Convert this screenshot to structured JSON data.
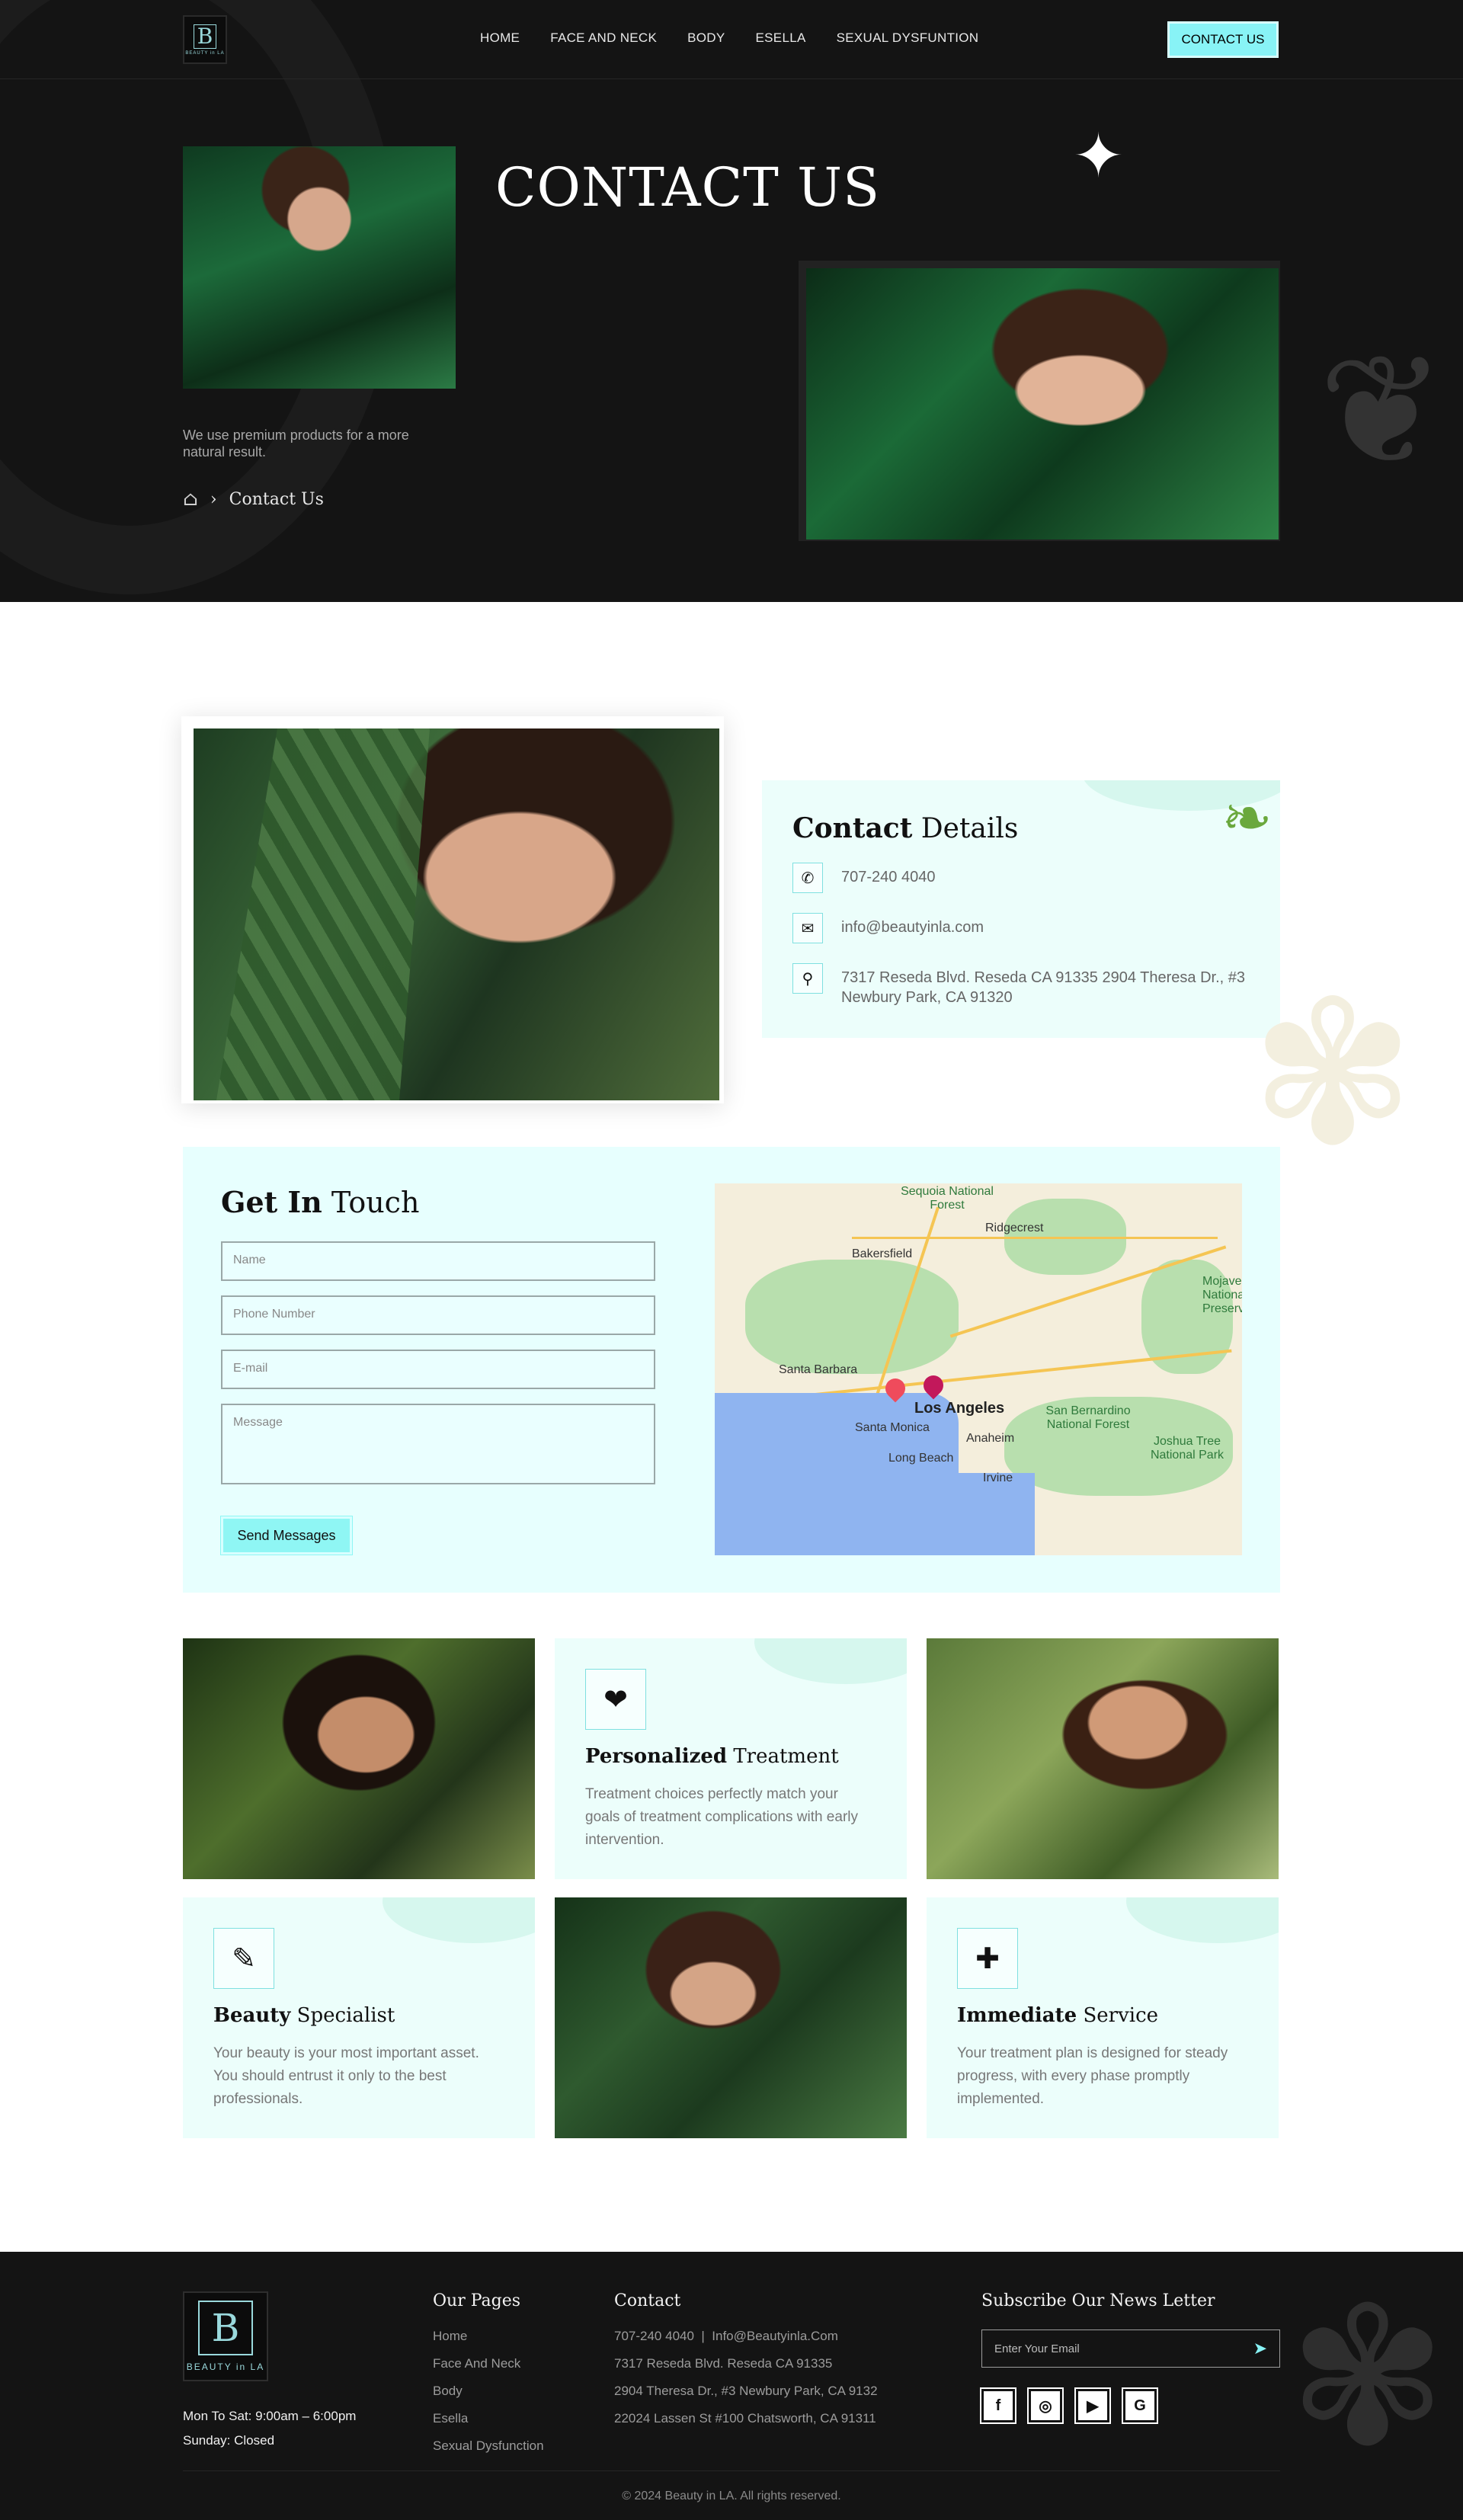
{
  "nav": {
    "logo_text": "BEAUTY in LA",
    "links": [
      "HOME",
      "FACE AND NECK",
      "BODY",
      "ESELLA",
      "SEXUAL DYSFUNTION"
    ],
    "cta": "CONTACT US"
  },
  "hero": {
    "title": "CONTACT US",
    "description": "We use premium products for a more natural result.",
    "breadcrumb": "Contact Us"
  },
  "contact_details": {
    "title_bold": "Contact",
    "title_rest": "Details",
    "phone": "707-240 4040",
    "email": "info@beautyinla.com",
    "address": "7317 Reseda Blvd. Reseda CA 91335 2904 Theresa Dr., #3 Newbury Park, CA 91320"
  },
  "get_in_touch": {
    "title_bold": "Get In",
    "title_rest": "Touch",
    "placeholders": {
      "name": "Name",
      "phone": "Phone Number",
      "email": "E-mail",
      "message": "Message"
    },
    "send_label": "Send Messages",
    "map_labels": {
      "sequoia": "Sequoia National Forest",
      "ridgecrest": "Ridgecrest",
      "bakersfield": "Bakersfield",
      "santa_barbara": "Santa Barbara",
      "los_angeles": "Los Angeles",
      "santa_monica": "Santa Monica",
      "long_beach": "Long Beach",
      "anaheim": "Anaheim",
      "irvine": "Irvine",
      "san_bernardino": "San Bernardino National Forest",
      "joshua_tree": "Joshua Tree National Park",
      "mojave": "Mojave National Preserve"
    }
  },
  "features": [
    {
      "icon": "heartbeat-icon",
      "title_bold": "Personalized",
      "title_rest": "Treatment",
      "text": "Treatment choices perfectly match your goals of treatment complications with early intervention."
    },
    {
      "icon": "tube-icon",
      "title_bold": "Beauty",
      "title_rest": "Specialist",
      "text": "Your beauty is your most important asset. You should entrust it only to the best professionals."
    },
    {
      "icon": "medkit-icon",
      "title_bold": "Immediate",
      "title_rest": "Service",
      "text": "Your treatment plan is designed for steady progress, with every phase promptly implemented."
    }
  ],
  "footer": {
    "logo_text": "BEAUTY in LA",
    "hours_weekday": "Mon To Sat: 9:00am – 6:00pm",
    "hours_sunday": "Sunday: Closed",
    "pages_title": "Our Pages",
    "pages": [
      "Home",
      "Face And  Neck",
      "Body",
      "Esella",
      "Sexual Dysfunction"
    ],
    "contact_title": "Contact",
    "contact_phone": "707-240 4040",
    "contact_email": "Info@Beautyinla.Com",
    "contact_lines": [
      "7317 Reseda Blvd. Reseda CA 91335",
      "2904 Theresa Dr., #3 Newbury Park, CA 9132",
      "22024 Lassen St #100 Chatsworth, CA 91311"
    ],
    "newsletter_title": "Subscribe Our News Letter",
    "newsletter_placeholder": "Enter Your Email",
    "social": [
      "f",
      "◎",
      "▶",
      "G"
    ],
    "copyright": "© 2024 Beauty in LA. All rights reserved."
  },
  "colors": {
    "accent": "#88f3f6",
    "dark_bg": "#141414",
    "card_bg": "#ecfefb",
    "form_bg": "#e7fffe"
  }
}
